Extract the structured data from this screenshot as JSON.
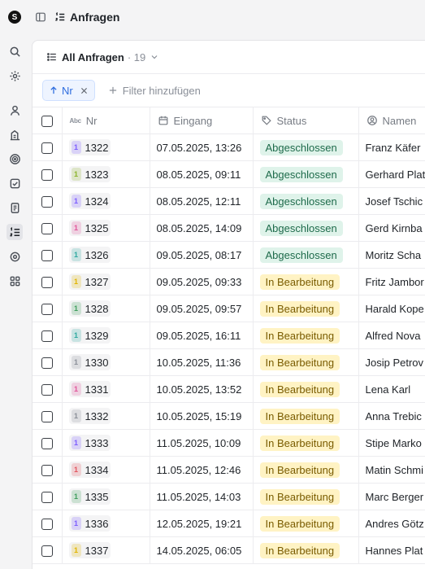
{
  "app": {
    "logo_letter": "S",
    "page_title": "Anfragen"
  },
  "view": {
    "name": "All Anfragen",
    "count": "· 19"
  },
  "filters": {
    "sort_chip_label": "Nr",
    "add_filter_label": "Filter hinzufügen"
  },
  "columns": {
    "nr": "Nr",
    "eingang": "Eingang",
    "status": "Status",
    "namen": "Namen",
    "abc_glyph": "Abc"
  },
  "colors": {
    "purple": "#7c5cff",
    "lime": "#8bb32b",
    "pink": "#e0559a",
    "teal": "#2ea8a0",
    "yellow": "#e0b400",
    "green": "#3f9e5d",
    "gray": "#8a8f98",
    "red": "#e2555f"
  },
  "rows": [
    {
      "tag": "1",
      "tag_color": "purple",
      "nr": "1322",
      "eingang": "07.05.2025, 13:26",
      "status": "Abgeschlossen",
      "status_kind": "done",
      "name": "Franz Käfer"
    },
    {
      "tag": "1",
      "tag_color": "lime",
      "nr": "1323",
      "eingang": "08.05.2025, 09:11",
      "status": "Abgeschlossen",
      "status_kind": "done",
      "name": "Gerhard Plat"
    },
    {
      "tag": "1",
      "tag_color": "purple",
      "nr": "1324",
      "eingang": "08.05.2025, 12:11",
      "status": "Abgeschlossen",
      "status_kind": "done",
      "name": "Josef Tschic"
    },
    {
      "tag": "1",
      "tag_color": "pink",
      "nr": "1325",
      "eingang": "08.05.2025, 14:09",
      "status": "Abgeschlossen",
      "status_kind": "done",
      "name": "Gerd Kirnba"
    },
    {
      "tag": "1",
      "tag_color": "teal",
      "nr": "1326",
      "eingang": "09.05.2025, 08:17",
      "status": "Abgeschlossen",
      "status_kind": "done",
      "name": "Moritz Scha"
    },
    {
      "tag": "1",
      "tag_color": "yellow",
      "nr": "1327",
      "eingang": "09.05.2025, 09:33",
      "status": "In Bearbeitung",
      "status_kind": "work",
      "name": "Fritz Jambor"
    },
    {
      "tag": "1",
      "tag_color": "green",
      "nr": "1328",
      "eingang": "09.05.2025, 09:57",
      "status": "In Bearbeitung",
      "status_kind": "work",
      "name": "Harald Kope"
    },
    {
      "tag": "1",
      "tag_color": "teal",
      "nr": "1329",
      "eingang": "09.05.2025, 16:11",
      "status": "In Bearbeitung",
      "status_kind": "work",
      "name": "Alfred Nova"
    },
    {
      "tag": "1",
      "tag_color": "gray",
      "nr": "1330",
      "eingang": "10.05.2025, 11:36",
      "status": "In Bearbeitung",
      "status_kind": "work",
      "name": "Josip Petrov"
    },
    {
      "tag": "1",
      "tag_color": "pink",
      "nr": "1331",
      "eingang": "10.05.2025, 13:52",
      "status": "In Bearbeitung",
      "status_kind": "work",
      "name": "Lena Karl"
    },
    {
      "tag": "1",
      "tag_color": "gray",
      "nr": "1332",
      "eingang": "10.05.2025, 15:19",
      "status": "In Bearbeitung",
      "status_kind": "work",
      "name": "Anna Trebic"
    },
    {
      "tag": "1",
      "tag_color": "purple",
      "nr": "1333",
      "eingang": "11.05.2025, 10:09",
      "status": "In Bearbeitung",
      "status_kind": "work",
      "name": "Stipe Marko"
    },
    {
      "tag": "1",
      "tag_color": "red",
      "nr": "1334",
      "eingang": "11.05.2025, 12:46",
      "status": "In Bearbeitung",
      "status_kind": "work",
      "name": "Matin Schmi"
    },
    {
      "tag": "1",
      "tag_color": "green",
      "nr": "1335",
      "eingang": "11.05.2025, 14:03",
      "status": "In Bearbeitung",
      "status_kind": "work",
      "name": "Marc Berger"
    },
    {
      "tag": "1",
      "tag_color": "purple",
      "nr": "1336",
      "eingang": "12.05.2025, 19:21",
      "status": "In Bearbeitung",
      "status_kind": "work",
      "name": "Andres Götz"
    },
    {
      "tag": "1",
      "tag_color": "yellow",
      "nr": "1337",
      "eingang": "14.05.2025, 06:05",
      "status": "In Bearbeitung",
      "status_kind": "work",
      "name": "Hannes Plat"
    }
  ]
}
